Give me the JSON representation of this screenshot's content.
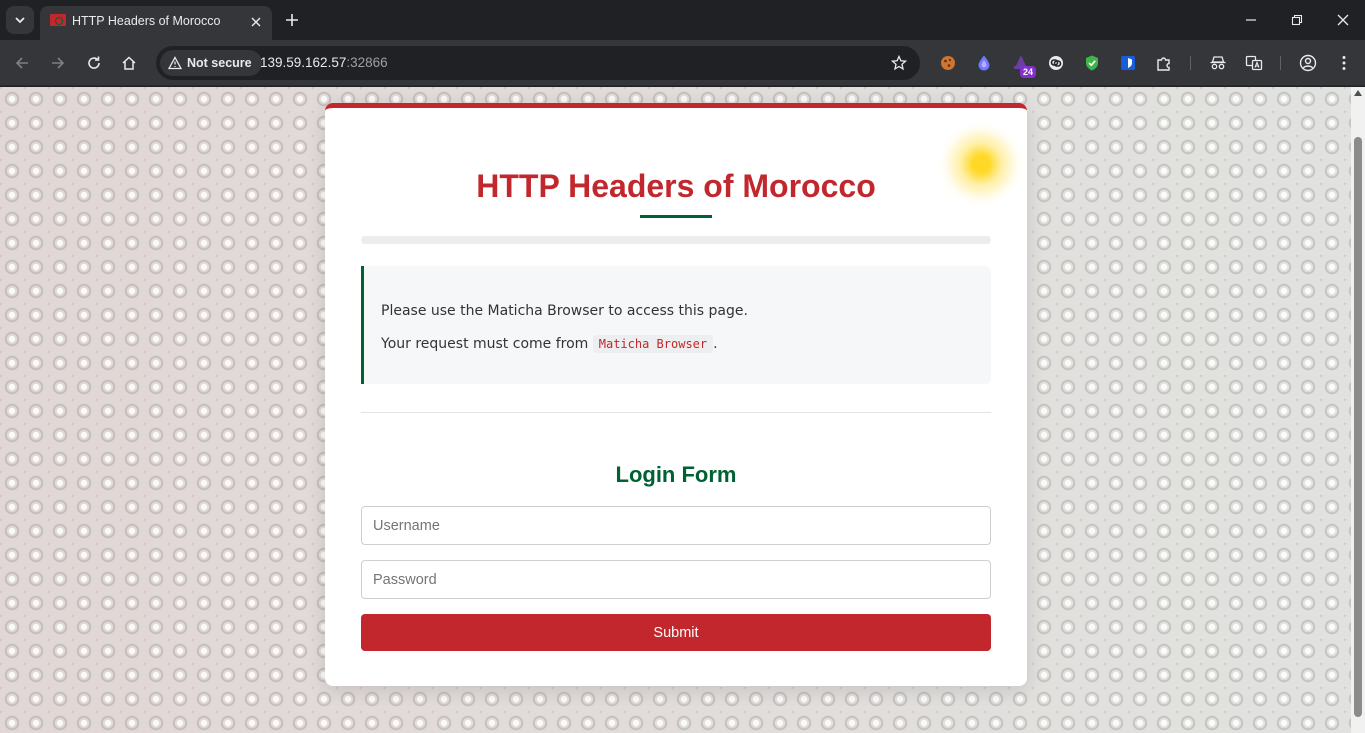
{
  "browser": {
    "tab_title": "HTTP Headers of Morocco",
    "security_label": "Not secure",
    "url_host": "139.59.162.57",
    "url_port": ":32866",
    "extension_badge": "24"
  },
  "page": {
    "title": "HTTP Headers of Morocco",
    "progress": 0,
    "alert_line1": "Please use the Maticha Browser to access this page.",
    "alert_line2_prefix": "Your request must come from",
    "alert_code": "Maticha Browser",
    "alert_line2_suffix": ".",
    "form_title": "Login Form",
    "username_placeholder": "Username",
    "password_placeholder": "Password",
    "submit_label": "Submit"
  },
  "colors": {
    "accent_red": "#c1272d",
    "accent_green": "#006233"
  }
}
